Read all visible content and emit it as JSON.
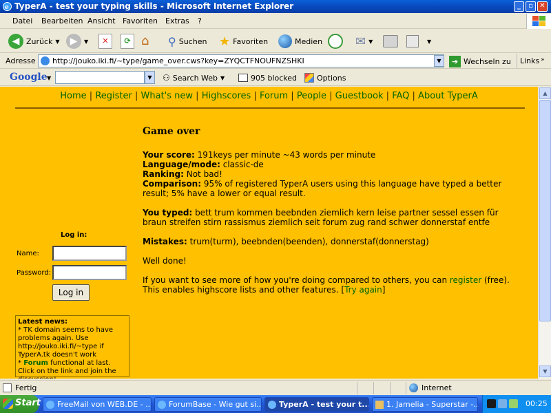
{
  "window": {
    "title": "TyperA - test your typing skills - Microsoft Internet Explorer"
  },
  "menu": [
    "Datei",
    "Bearbeiten",
    "Ansicht",
    "Favoriten",
    "Extras",
    "?"
  ],
  "toolbar": {
    "back": "Zurück",
    "search": "Suchen",
    "favorites": "Favoriten",
    "media": "Medien"
  },
  "address": {
    "label": "Adresse",
    "url": "http://jouko.iki.fi/~type/game_over.cws?key=ZYQCTFNOUFNZSHKI",
    "go": "Wechseln zu",
    "links": "Links"
  },
  "googlebar": {
    "logo": "Google",
    "search_web": "Search Web",
    "blocked": "905 blocked",
    "options": "Options"
  },
  "nav": [
    "Home",
    "Register",
    "What's new",
    "Highscores",
    "Forum",
    "People",
    "Guestbook",
    "FAQ",
    "About TyperA"
  ],
  "main": {
    "heading": "Game over",
    "score_label": "Your score:",
    "score_value": "191keys per minute ~43 words per minute",
    "lang_label": "Language/mode:",
    "lang_value": "classic-de",
    "rank_label": "Ranking:",
    "rank_value": "Not bad!",
    "comp_label": "Comparison:",
    "comp_value": "95% of registered TyperA users using this language have typed a better result; 5% have a lower or equal result.",
    "typed_label": "You typed:",
    "typed_value": "bett trum kommen beebnden ziemlich kern leise partner sessel essen für braun streifen stirn rassismus ziemlich seit forum zug rand schwer donnerstaf entfe",
    "mistakes_label": "Mistakes:",
    "mistakes_value": "trum(turm), beebnden(beenden), donnerstaf(donnerstag)",
    "welldone": "Well done!",
    "info_prefix": "If you want to see more of how you're doing compared to others, you can",
    "info_register": "register",
    "info_suffix": "(free). This enables highscore lists and other features.",
    "try_again": "Try again"
  },
  "login": {
    "title": "Log in:",
    "name_label": "Name:",
    "password_label": "Password:",
    "button": "Log in"
  },
  "news": {
    "title": "Latest news:",
    "item1": "* TK domain seems to have problems again. Use http://jouko.iki.fi/~type if TyperA.tk doesn't work",
    "item2_prefix": "*",
    "item2_link": "Forum",
    "item2_suffix": "functional at last. Click on the link and join the discussion!"
  },
  "status": {
    "text": "Fertig",
    "zone": "Internet"
  },
  "taskbar": {
    "start": "Start",
    "tasks": [
      "FreeMail von WEB.DE - ...",
      "ForumBase - Wie gut si...",
      "TyperA - test your t...",
      "1. Jamelia - Superstar -..."
    ],
    "clock": "00:25"
  }
}
